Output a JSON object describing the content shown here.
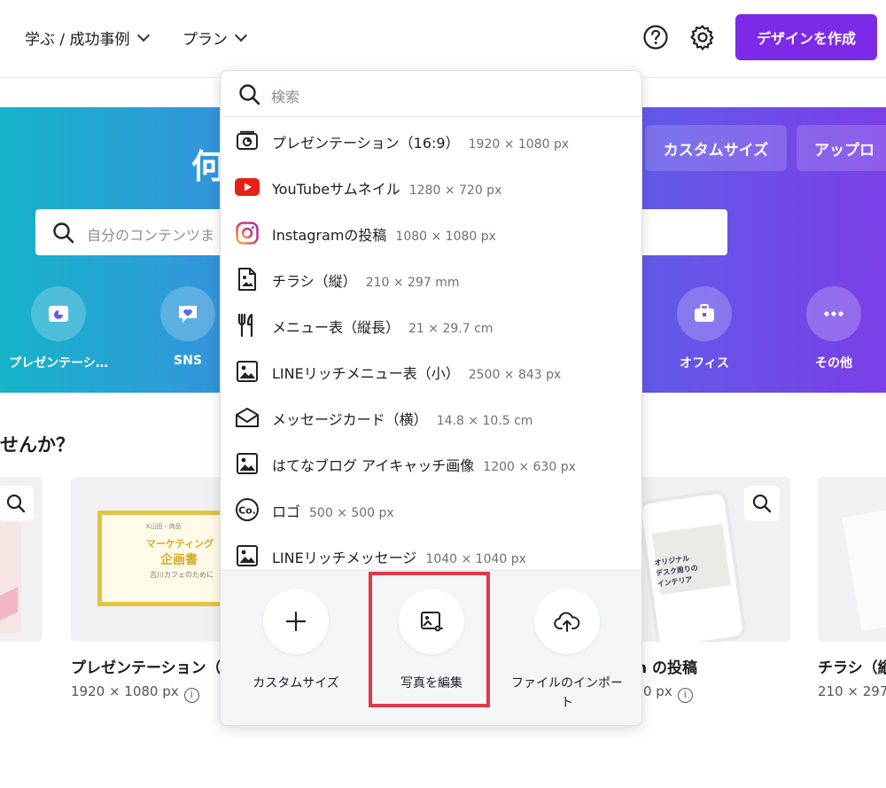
{
  "topbar": {
    "nav_learn": "学ぶ / 成功事例",
    "nav_plans": "プラン",
    "create_button": "デザインを作成",
    "icons": [
      "help-icon",
      "gear-icon"
    ]
  },
  "hero": {
    "title": "何",
    "search_placeholder": "自分のコンテンツま",
    "chips": [
      "カスタムサイズ",
      "アップロ"
    ],
    "categories": [
      "プレゼンテーシ…",
      "SNS",
      "オフィス",
      "その他"
    ]
  },
  "section": {
    "title": "せんか？"
  },
  "cards": [
    {
      "title": "プレゼンテーション（",
      "size": "1920 × 1080 px",
      "thumb_title": "マーケティング",
      "thumb_title2": "企画書",
      "thumb_sub": "吉川カフェのために",
      "thumb_top": "K山田・商品"
    },
    {
      "title": "n の投稿",
      "size": "0 px",
      "thumb_text1": "オリジナル",
      "thumb_text2": "デスク周りの",
      "thumb_text3": "インテリア"
    },
    {
      "title": "チラシ（縦",
      "size": "210 × 297 m"
    }
  ],
  "dropdown": {
    "search_placeholder": "検索",
    "items": [
      {
        "name": "プレゼンテーション（16:9）",
        "dim": "1920 × 1080 px",
        "icon": "presentation-icon"
      },
      {
        "name": "YouTubeサムネイル",
        "dim": "1280 × 720 px",
        "icon": "youtube-icon"
      },
      {
        "name": "Instagramの投稿",
        "dim": "1080 × 1080 px",
        "icon": "instagram-icon"
      },
      {
        "name": "チラシ（縦）",
        "dim": "210 × 297 mm",
        "icon": "flyer-icon"
      },
      {
        "name": "メニュー表（縦長）",
        "dim": "21 × 29.7 cm",
        "icon": "menu-utensils-icon"
      },
      {
        "name": "LINEリッチメニュー表（小）",
        "dim": "2500 × 843 px",
        "icon": "image-icon"
      },
      {
        "name": "メッセージカード（横）",
        "dim": "14.8 × 10.5 cm",
        "icon": "envelope-icon"
      },
      {
        "name": "はてなブログ アイキャッチ画像",
        "dim": "1200 × 630 px",
        "icon": "image-icon"
      },
      {
        "name": "ロゴ",
        "dim": "500 × 500 px",
        "icon": "logo-co-icon"
      },
      {
        "name": "LINEリッチメッセージ",
        "dim": "1040 × 1040 px",
        "icon": "image-icon"
      }
    ],
    "actions": [
      {
        "label": "カスタムサイズ",
        "icon": "plus-icon"
      },
      {
        "label": "写真を編集",
        "icon": "photo-edit-icon"
      },
      {
        "label_line1": "ファイルのインポー",
        "label_line2": "ト",
        "icon": "cloud-upload-icon"
      }
    ]
  },
  "colors": {
    "accent": "#7d2ae8",
    "highlight": "#e03848",
    "youtube": "#e62117"
  }
}
